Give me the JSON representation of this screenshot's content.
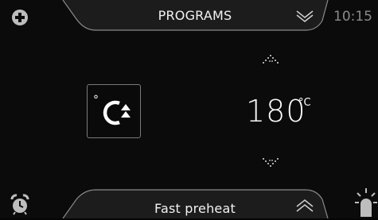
{
  "header": {
    "programs_label": "PROGRAMS",
    "time": "10:15"
  },
  "mode": {
    "degree_symbol": "°"
  },
  "temperature": {
    "value": "180",
    "unit": "°C"
  },
  "footer": {
    "function_label": "Fast preheat"
  },
  "icons": {
    "add": "plus-circle-icon",
    "chevron_down": "chevron-down-icon",
    "chevron_up": "chevron-up-icon",
    "alarm": "alarm-clock-icon",
    "light": "lamp-icon",
    "temp_up": "temperature-up-icon",
    "temp_down": "temperature-down-icon",
    "fast_preheat": "fast-preheat-icon"
  },
  "colors": {
    "background": "#0b0b0b",
    "panel": "#1a1a1a",
    "outline": "#8a8a8a",
    "text": "#ffffff",
    "dim_text": "#8a8a8a"
  }
}
